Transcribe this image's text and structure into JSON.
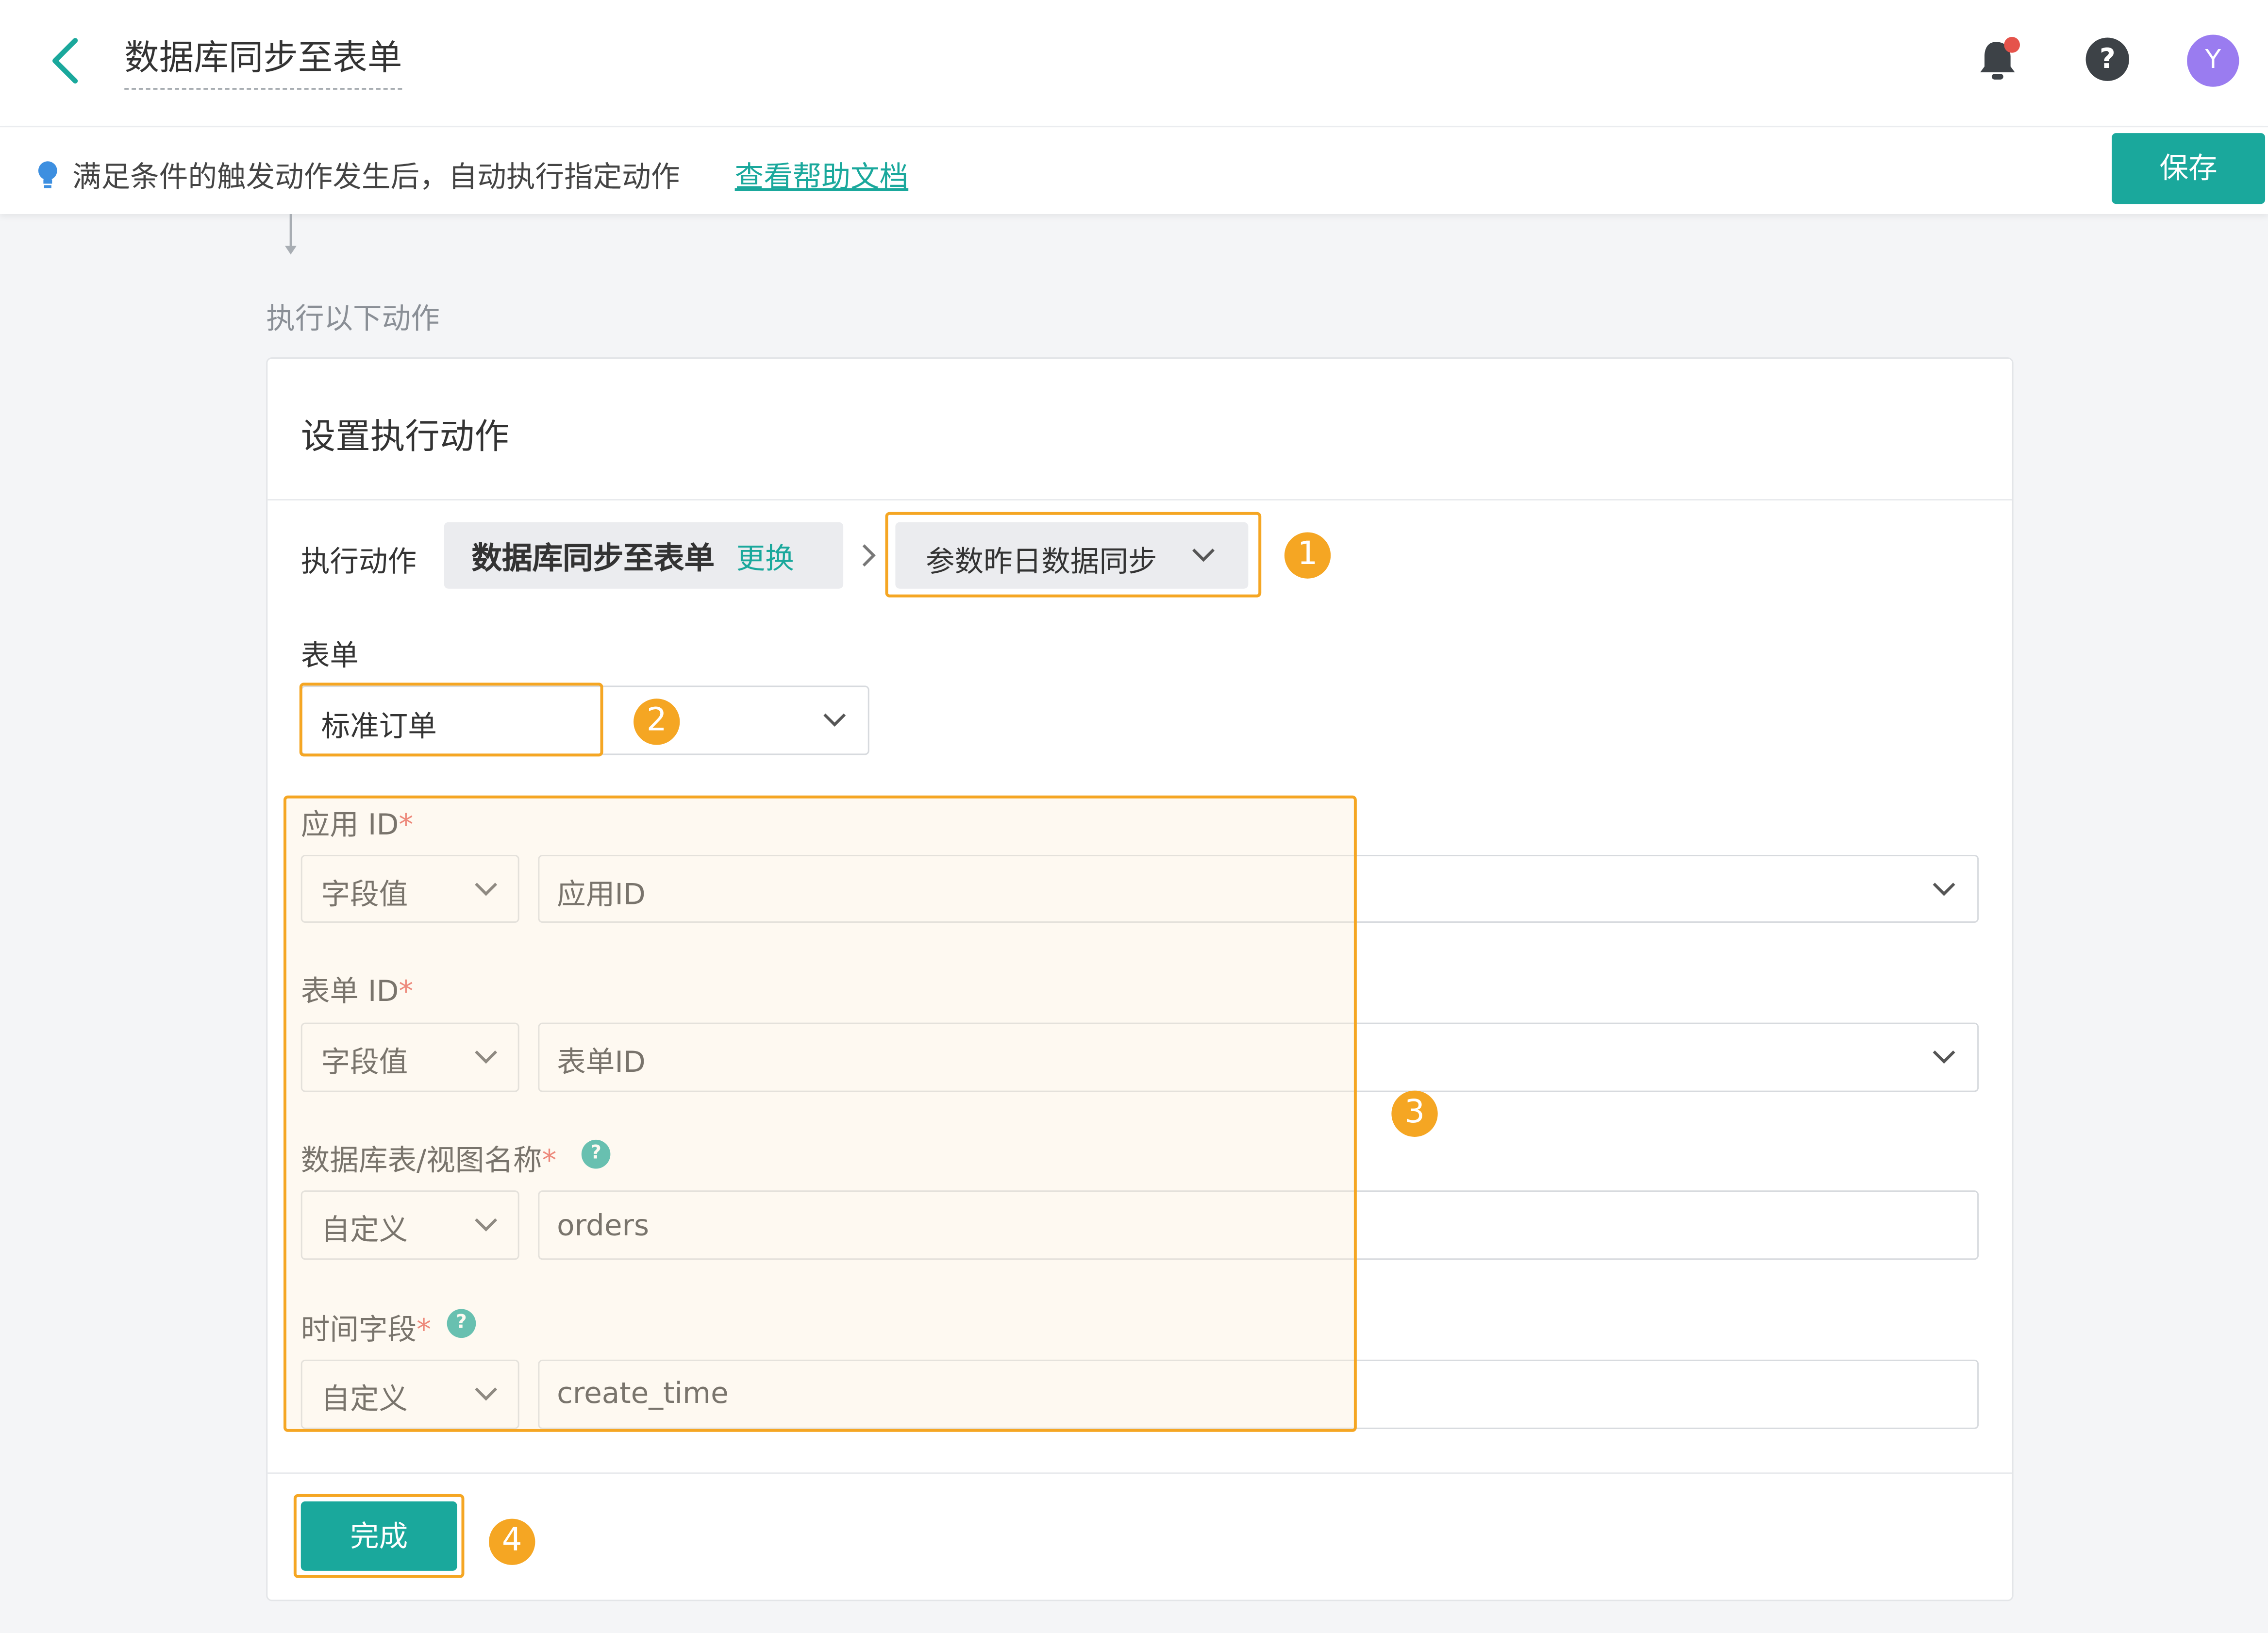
{
  "header": {
    "title": "数据库同步至表单",
    "avatar_initial": "Y"
  },
  "infobar": {
    "tip": "满足条件的触发动作发生后，自动执行指定动作",
    "help_link": "查看帮助文档",
    "save_label": "保存"
  },
  "section_label": "执行以下动作",
  "card": {
    "title": "设置执行动作",
    "action_label": "执行动作",
    "action_name": "数据库同步至表单",
    "change_link": "更换",
    "config_select": "参数昨日数据同步",
    "form_label": "表单",
    "form_value": "标准订单",
    "fields": [
      {
        "label": "应用 ID",
        "required": "*",
        "mode": "字段值",
        "value": "应用ID"
      },
      {
        "label": "表单 ID",
        "required": "*",
        "mode": "字段值",
        "value": "表单ID"
      },
      {
        "label": "数据库表/视图名称",
        "required": "*",
        "mode": "自定义",
        "value": "orders"
      },
      {
        "label": "时间字段",
        "required": "*",
        "mode": "自定义",
        "value": "create_time"
      }
    ],
    "done_label": "完成"
  },
  "markers": [
    "1",
    "2",
    "3",
    "4"
  ],
  "icons": [
    "back-arrow-icon",
    "bell-icon",
    "help-icon",
    "bulb-icon",
    "chevron-right-icon",
    "chevron-down-icon",
    "question-icon",
    "down-arrow-icon"
  ],
  "colors": {
    "accent": "#1aa89c",
    "highlight": "#f5a623",
    "required": "#e5534b",
    "avatar": "#9a7cf0",
    "notification_dot": "#e5534b"
  }
}
